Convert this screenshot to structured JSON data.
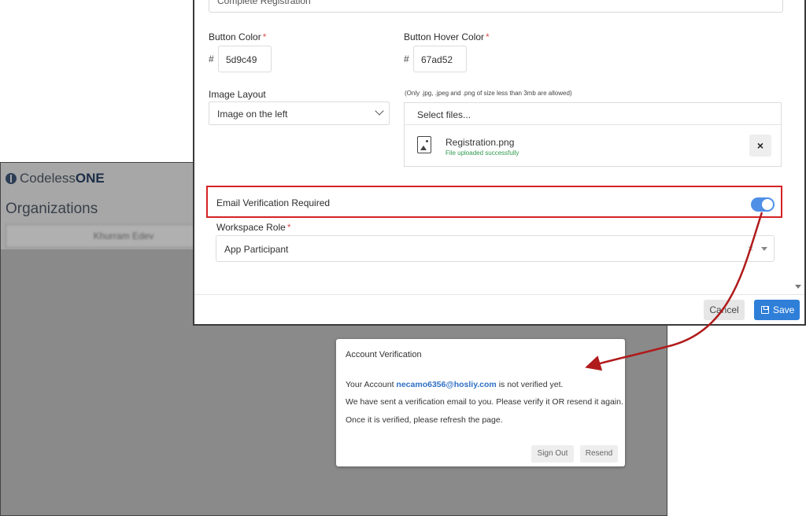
{
  "background_app": {
    "logo_text_plain": "Codeless",
    "logo_text_bold": "ONE",
    "page_title": "Organizations",
    "blurred_row": "Khurram Edev"
  },
  "form": {
    "first_field_value": "Complete Registration",
    "button_color_label": "Button Color",
    "button_color_value": "5d9c49",
    "button_hover_color_label": "Button Hover Color",
    "button_hover_color_value": "67ad52",
    "hash_symbol": "#",
    "required_mark": "*",
    "image_layout_label": "Image Layout",
    "image_layout_value": "Image on the left",
    "upload_note": "(Only .jpg, .jpeg and .png of size less than 3mb are allowed)",
    "select_files_label": "Select files...",
    "file_name": "Registration.png",
    "file_status": "File uploaded successfully",
    "remove_file": "×",
    "email_verification_label": "Email Verification Required",
    "email_verification_enabled": true,
    "workspace_role_label": "Workspace Role",
    "workspace_role_value": "App Participant",
    "clear_symbol": "×",
    "cancel_label": "Cancel",
    "save_label": "Save"
  },
  "dialog": {
    "title": "Account Verification",
    "line1_prefix": "Your Account ",
    "line1_email": "necamo6356@hosliy.com",
    "line1_suffix": " is not verified yet.",
    "line2": "We have sent a verification email to you. Please verify it OR resend it again.",
    "line3": "Once it is verified, please refresh the page.",
    "sign_out_label": "Sign Out",
    "resend_label": "Resend"
  },
  "colors": {
    "highlight_border": "#d62224",
    "toggle_on": "#4f8fe6",
    "save_button": "#2f7fd8",
    "email_link": "#2f6fc4",
    "success_text": "#2f9a4e",
    "arrow": "#b01b1b"
  }
}
